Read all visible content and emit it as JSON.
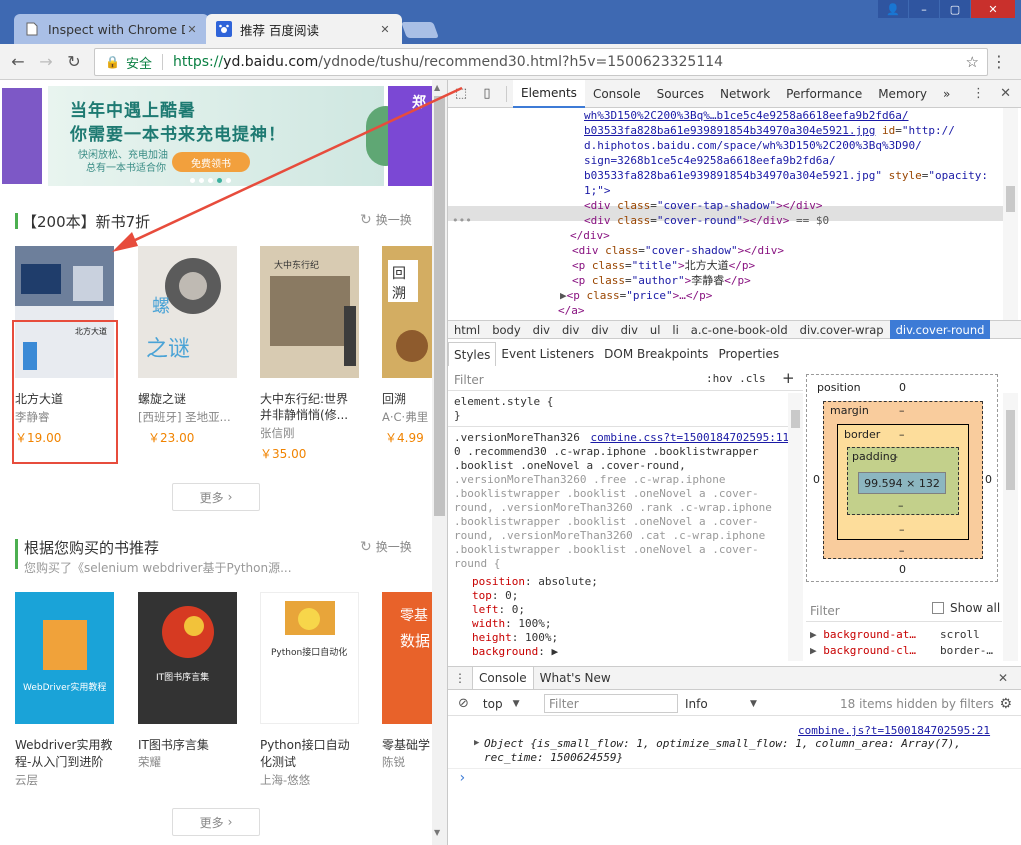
{
  "browser": {
    "tabs": [
      {
        "title": "Inspect with Chrome Dev",
        "icon": "document-icon",
        "active": false
      },
      {
        "title": "推荐 百度阅读",
        "icon": "baidu-paw-icon",
        "active": true
      }
    ],
    "address": {
      "secure_label": "安全",
      "scheme": "https://",
      "host": "yd.baidu.com",
      "path": "/ydnode/tushu/recommend30.html?h5v=1500623325114"
    }
  },
  "page": {
    "banner": {
      "line1": "当年中遇上酷暑",
      "line2": "你需要一本书来充电提神！",
      "line3": "快闲放松、充电加油",
      "line4": "总有一本书适合你",
      "button": "免费领书 "
    },
    "section1": {
      "title": "【200本】新书7折",
      "refresh": "换一换",
      "books": [
        {
          "title": "北方大道",
          "author": "李静睿",
          "price": "￥19.00"
        },
        {
          "title": "螺旋之谜",
          "author": "[西班牙] 圣地亚...",
          "price": "￥23.00"
        },
        {
          "title": "大中东行纪:世界",
          "title2": "并非静悄悄(修...",
          "author": "张信刚",
          "price": "￥35.00"
        },
        {
          "title": "回溯",
          "author": "A·C·弗里",
          "price": "￥4.99"
        }
      ],
      "more": "更多"
    },
    "section2": {
      "title": "根据您购买的书推荐",
      "subtitle": "您购买了《selenium webdriver基于Python源...",
      "refresh": "换一换",
      "books": [
        {
          "title": "Webdriver实用教",
          "title2": "程-从入门到进阶",
          "author": "云层"
        },
        {
          "title": "IT图书序言集",
          "author": "荣耀"
        },
        {
          "title": "Python接口自动",
          "title2": "化测试",
          "author": "上海-悠悠"
        },
        {
          "title": "零基础学",
          "author": "陈锐"
        }
      ],
      "more": "更多"
    }
  },
  "devtools": {
    "tabs": [
      "Elements",
      "Console",
      "Sources",
      "Network",
      "Performance",
      "Memory"
    ],
    "breadcrumbs": [
      "html",
      "body",
      "div",
      "div",
      "div",
      "div",
      "ul",
      "li",
      "a.c-one-book-old",
      "div.cover-wrap",
      "div.cover-round"
    ],
    "elements_lines": {
      "l1": "wh%3D150%2C200%3Bq%…b1ce5c4e9258a6618eefa9b2fd6a/",
      "l2": "b03533fa828ba61e939891854b34970a304e5921.jpg",
      "l2b": "id",
      "l2c": "\"http://",
      "l3": "d.hiphotos.baidu.com/space/wh%3D150%2C200%3Bq%3D90/",
      "l4": "sign=3268b1ce5c4e9258a6618eefa9b2fd6a/",
      "l5": "b03533fa828ba61e939891854b34970a304e5921.jpg\"",
      "l5b": "style",
      "l5c": "\"opacity:",
      "l6": "1;\">",
      "cover_tap_shadow": "cover-tap-shadow",
      "cover_round": "cover-round",
      "eq0": "== $0",
      "cover_shadow": "cover-shadow",
      "title_cls": "title",
      "title_text": "北方大道",
      "author_cls": "author",
      "author_text": "李静睿",
      "price_cls": "price"
    },
    "styles_tabs": [
      "Styles",
      "Event Listeners",
      "DOM Breakpoints",
      "Properties"
    ],
    "filter_placeholder": "Filter",
    "hov_cls": ":hov  .cls",
    "styles": {
      "element_style": "element.style {",
      "close": "}",
      "rule_sel1": ".versionMoreThan326",
      "rule_link": "combine.css?t=1500184702595:11",
      "rule_sel2": "0 .recommend30 .c-wrap.iphone .booklistwrapper",
      "rule_sel3": ".booklist .oneNovel a .cover-round,",
      "grey1": ".versionMoreThan3260 .free .c-wrap.iphone",
      "grey2": ".booklistwrapper .booklist .oneNovel a .cover-",
      "grey3": "round, .versionMoreThan3260 .rank .c-wrap.iphone",
      "grey4": ".booklistwrapper .booklist .oneNovel a .cover-",
      "grey5": "round, .versionMoreThan3260 .cat .c-wrap.iphone",
      "grey6": ".booklistwrapper .booklist .oneNovel a .cover-",
      "grey7": "round {",
      "props": [
        {
          "name": "position",
          "value": "absolute;"
        },
        {
          "name": "top",
          "value": "0;"
        },
        {
          "name": "left",
          "value": "0;"
        },
        {
          "name": "width",
          "value": "100%;"
        },
        {
          "name": "height",
          "value": "100%;"
        },
        {
          "name": "background",
          "value": "▶"
        }
      ]
    },
    "boxmodel": {
      "position": "position",
      "margin": "margin",
      "border": "border",
      "padding": "padding",
      "content": "99.594 × 132",
      "zero": "0",
      "dash": "–",
      "dash2": "-"
    },
    "computed_filter": "Filter",
    "show_all": "Show all",
    "computed": [
      {
        "name": "background-at…",
        "value": "scroll"
      },
      {
        "name": "background-cl…",
        "value": "border-…"
      }
    ],
    "drawer_tabs": [
      "Console",
      "What's New"
    ],
    "console": {
      "context": "top",
      "filter": "Filter",
      "level": "Info",
      "hidden": "18 items hidden by filters",
      "source": "combine.js?t=1500184702595:21",
      "obj_line1": "Object {is_small_flow: 1, optimize_small_flow: 1, column_area: Array(7),",
      "obj_line2": "rec_time: 1500624559}",
      "prompt": "›"
    }
  },
  "colors": {
    "accent": "#3d7bd6",
    "price": "#f08300",
    "green": "#4caf50",
    "highlight": "#e74c3c"
  }
}
